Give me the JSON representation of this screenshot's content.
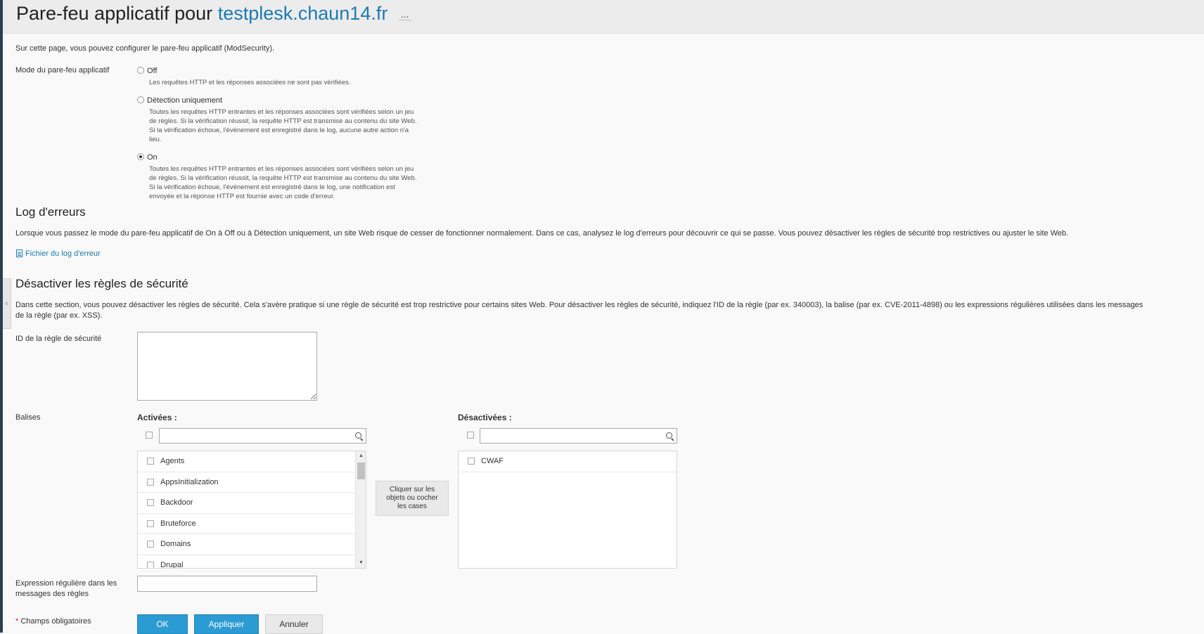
{
  "header": {
    "title_prefix": "Pare-feu applicatif pour",
    "domain": "testplesk.chaun14.fr",
    "more_label": "..."
  },
  "intro": "Sur cette page, vous pouvez configurer le pare-feu applicatif (ModSecurity).",
  "firewall_mode": {
    "label": "Mode du pare-feu applicatif",
    "selected": "On",
    "options": [
      {
        "label": "Off",
        "desc": [
          "Les requêtes HTTP et les réponses associées ne sont pas vérifiées."
        ]
      },
      {
        "label": "Détection uniquement",
        "desc": [
          "Toutes les requêtes HTTP entrantes et les réponses associées sont vérifiées selon un jeu",
          "de règles. Si la vérification réussit, la requête HTTP est transmise au contenu du site Web.",
          "Si la vérification échoue, l'événement est enregistré dans le log, aucune autre action n'a",
          "lieu."
        ]
      },
      {
        "label": "On",
        "desc": [
          "Toutes les requêtes HTTP entrantes et les réponses associées sont vérifiées selon un jeu",
          "de règles. Si la vérification réussit, la requête HTTP est transmise au contenu du site Web.",
          "Si la vérification échoue, l'événement est enregistré dans le log, une notification est",
          "envoyée et la réponse HTTP est fournie avec un code d'erreur."
        ]
      }
    ]
  },
  "error_log": {
    "title": "Log d'erreurs",
    "text": "Lorsque vous passez le mode du pare-feu applicatif de On à Off ou à Détection uniquement, un site Web risque de cesser de fonctionner normalement. Dans ce cas, analysez le log d'erreurs pour découvrir ce qui se passe. Vous pouvez désactiver les règles de sécurité trop restrictives ou ajuster le site Web.",
    "link": "Fichier du log d'erreur"
  },
  "disable_rules": {
    "title": "Désactiver les règles de sécurité",
    "text_line1": "Dans cette section, vous pouvez désactiver les règles de sécurité. Cela s'avère pratique si une règle de sécurité est trop restrictive pour certains sites Web. Pour désactiver les règles de sécurité, indiquez l'ID de la règle (par ex. 340003), la balise (par ex. CVE-2011-4898) ou les expressions régulières utilisées dans les messages",
    "text_line2": "de la règle (par ex. XSS).",
    "rule_id_label": "ID de la règle de sécurité",
    "rule_id_value": "",
    "tags_label": "Balises",
    "enabled_label": "Activées :",
    "disabled_label": "Désactivées :",
    "enabled_search": "",
    "disabled_search": "",
    "enabled_tags": [
      "Agents",
      "AppsInitialization",
      "Backdoor",
      "Bruteforce",
      "Domains",
      "Drupal"
    ],
    "disabled_tags": [
      "CWAF"
    ],
    "move_hint": "Cliquer sur les objets ou cocher les cases",
    "regex_label_line1": "Expression régulière dans les",
    "regex_label_line2": "messages des règles",
    "regex_value": ""
  },
  "footer": {
    "required_star": "*",
    "required_label": "Champs obligatoires",
    "ok": "OK",
    "apply": "Appliquer",
    "cancel": "Annuler"
  },
  "colors": {
    "accent": "#2b9bd4",
    "link": "#1e7bb0",
    "header_bg": "#ececec",
    "page_bg": "#f9f9f9"
  }
}
